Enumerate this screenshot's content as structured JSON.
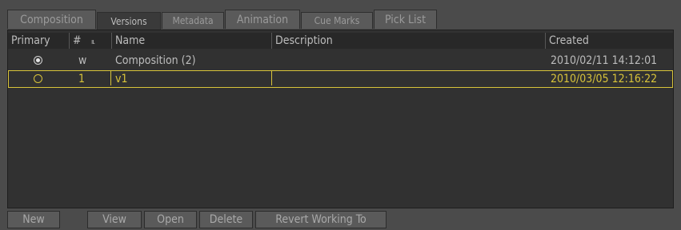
{
  "tabs": [
    {
      "label": "Composition"
    },
    {
      "label": "Versions"
    },
    {
      "label": "Metadata"
    },
    {
      "label": "Animation"
    },
    {
      "label": "Cue Marks"
    },
    {
      "label": "Pick List"
    }
  ],
  "table": {
    "headers": {
      "primary": "Primary",
      "num": "#",
      "sort": "ıı.",
      "name": "Name",
      "description": "Description",
      "created": "Created"
    },
    "rows": [
      {
        "primary": "selected",
        "num": "w",
        "name": "Composition (2)",
        "description": "",
        "created": "2010/02/11 14:12:01"
      },
      {
        "primary": "unselected",
        "num": "1",
        "name": "v1",
        "description": "",
        "created": "2010/03/05 12:16:22"
      }
    ]
  },
  "buttons": {
    "new": "New",
    "view": "View",
    "open": "Open",
    "delete": "Delete",
    "revert": "Revert Working To"
  },
  "colors": {
    "highlight": "#d9c43a",
    "panel": "#313131",
    "background": "#4b4b4b"
  }
}
